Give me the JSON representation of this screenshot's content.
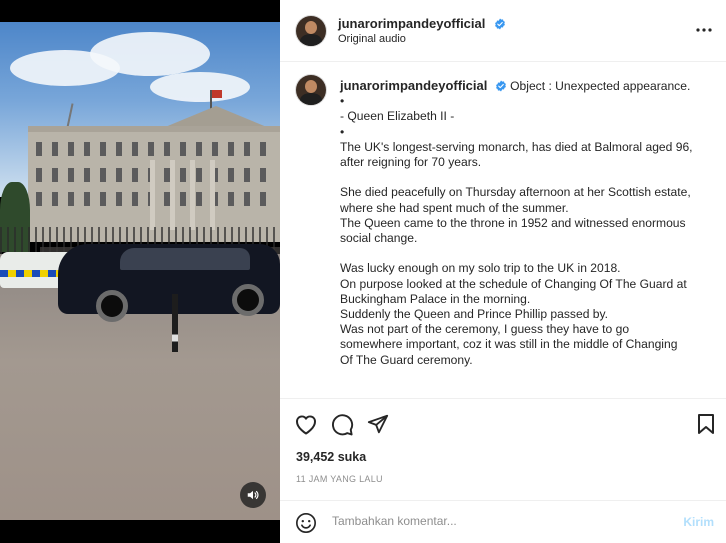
{
  "post": {
    "username": "junarorimpandeyofficial",
    "audio_label": "Original audio",
    "caption_title": "Object : Unexpected appearance.",
    "caption_lines": [
      "•",
      "- Queen Elizabeth II -",
      "•",
      "The UK's longest-serving monarch, has died at Balmoral aged 96,",
      "after reigning for 70 years.",
      "",
      "She died peacefully on Thursday afternoon at her Scottish estate,",
      "where she had spent much of the summer.",
      "The Queen came to the throne in 1952 and witnessed enormous",
      "social change.",
      "",
      "Was lucky enough on my solo trip to the UK in 2018.",
      "On purpose looked at the schedule of Changing Of The Guard at",
      "Buckingham Palace in the morning.",
      "Suddenly the Queen and Prince Phillip passed by.",
      "Was not part of the ceremony, I guess they have to go",
      "somewhere important, coz it was still in the middle of Changing",
      "Of The Guard ceremony."
    ],
    "likes": "39,452 suka",
    "timestamp": "11 JAM YANG LALU"
  },
  "comment": {
    "placeholder": "Tambahkan komentar...",
    "post_label": "Kirim"
  },
  "icons": {
    "verified": "verified-badge-icon",
    "more": "more-options-icon",
    "like": "heart-icon",
    "comment": "comment-icon",
    "share": "share-icon",
    "save": "bookmark-icon",
    "emoji": "emoji-icon",
    "audio": "audio-toggle-icon"
  },
  "colors": {
    "verified_blue": "#3897f0",
    "post_button_disabled": "#b2dffc",
    "secondary_text": "#8e8e8e"
  }
}
